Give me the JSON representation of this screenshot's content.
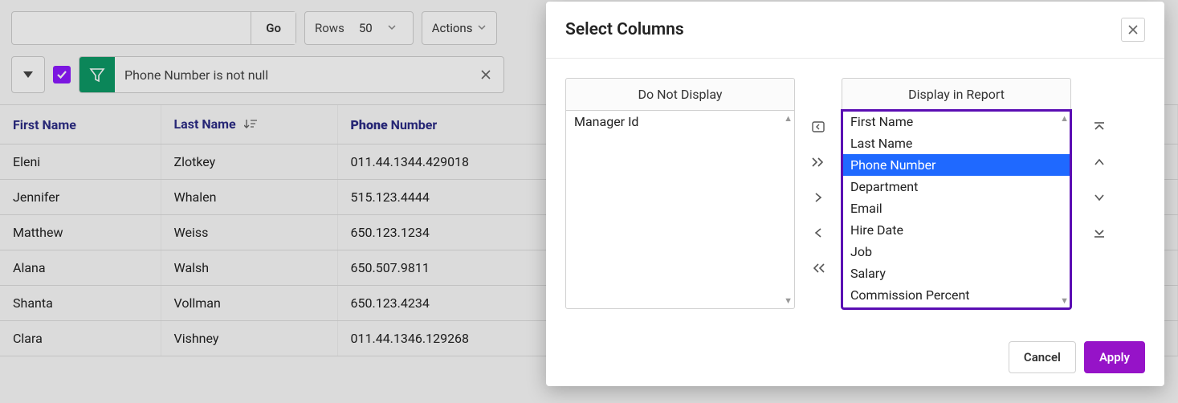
{
  "toolbar": {
    "search_value": "",
    "go_label": "Go",
    "rows_label": "Rows",
    "rows_value": "50",
    "actions_label": "Actions"
  },
  "filter": {
    "text": "Phone Number is not null",
    "checked": true
  },
  "grid": {
    "columns": [
      {
        "label": "First Name",
        "id": "first-name"
      },
      {
        "label": "Last Name",
        "id": "last-name",
        "sorted_desc": true
      },
      {
        "label_html_prefix": "Phone",
        "label_html_rest": " Number",
        "id": "phone-number"
      }
    ],
    "rows": [
      {
        "first": "Eleni",
        "last": "Zlotkey",
        "phone": "011.44.1344.429018"
      },
      {
        "first": "Jennifer",
        "last": "Whalen",
        "phone": "515.123.4444"
      },
      {
        "first": "Matthew",
        "last": "Weiss",
        "phone": "650.123.1234"
      },
      {
        "first": "Alana",
        "last": "Walsh",
        "phone": "650.507.9811"
      },
      {
        "first": "Shanta",
        "last": "Vollman",
        "phone": "650.123.4234"
      },
      {
        "first": "Clara",
        "last": "Vishney",
        "phone": "011.44.1346.129268"
      }
    ]
  },
  "dialog": {
    "title": "Select Columns",
    "left_title": "Do Not Display",
    "right_title": "Display in Report",
    "left_items": [
      {
        "label": "Manager Id",
        "selected": false
      }
    ],
    "right_items": [
      {
        "label": "First Name",
        "selected": false
      },
      {
        "label": "Last Name",
        "selected": false
      },
      {
        "label": "Phone Number",
        "selected": true
      },
      {
        "label": "Department",
        "selected": false
      },
      {
        "label": "Email",
        "selected": false
      },
      {
        "label": "Hire Date",
        "selected": false
      },
      {
        "label": "Job",
        "selected": false
      },
      {
        "label": "Salary",
        "selected": false
      },
      {
        "label": "Commission Percent",
        "selected": false
      }
    ],
    "cancel_label": "Cancel",
    "apply_label": "Apply"
  },
  "colors": {
    "accent": "#9613c8",
    "filter_green": "#0d9966",
    "selection_blue": "#1f69ff",
    "header_text": "#2c2c86"
  }
}
